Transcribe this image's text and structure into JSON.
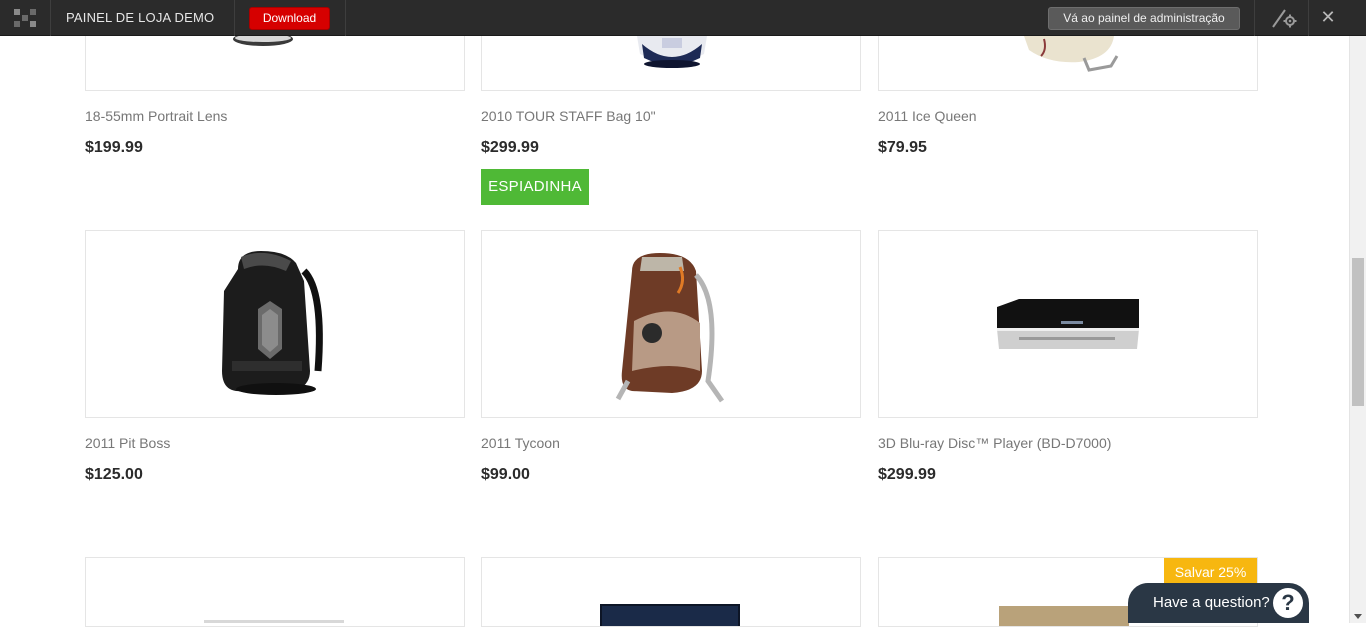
{
  "topbar": {
    "store_title": "PAINEL DE LOJA DEMO",
    "download_label": "Download",
    "admin_label": "Vá ao painel de administração",
    "close_label": "✕"
  },
  "products": [
    {
      "name": "18-55mm Portrait Lens",
      "price": "$199.99"
    },
    {
      "name": "2010 TOUR STAFF Bag 10\"",
      "price": "$299.99"
    },
    {
      "name": "2011 Ice Queen",
      "price": "$79.95"
    },
    {
      "name": "2011 Pit Boss",
      "price": "$125.00"
    },
    {
      "name": "2011 Tycoon",
      "price": "$99.00"
    },
    {
      "name": "3D Blu-ray Disc™ Player (BD-D7000)",
      "price": "$299.99"
    }
  ],
  "quickview_label": "ESPIADINHA",
  "sale_badge": "Salvar 25%",
  "chat": {
    "label": "Have a question?",
    "icon": "?"
  }
}
